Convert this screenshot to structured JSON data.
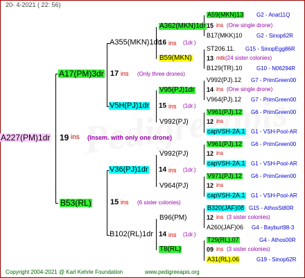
{
  "header": {
    "date": "20-  4-2021 ( 22: 56)"
  },
  "watermark": "Pedigreeapis",
  "root": {
    "name": "A227(PM)1dr",
    "ins_num": "19",
    "ins_text": "ins",
    "note": "(Insem. with only one drone)"
  },
  "gen1": [
    {
      "name": "A17(PM)3dr",
      "ins_num": "17",
      "ins_text": "ins",
      "note": "(Only three drones)"
    },
    {
      "name": "B53(RL)",
      "ins_num": "15",
      "ins_text": "ins",
      "note": "(6 sister colonies)"
    }
  ],
  "gen2": [
    {
      "name": "A355(MKN)1dr",
      "ins_num": "16",
      "ins_text": "ins",
      "note": "(1dr.)"
    },
    {
      "name": "V5H(PJ)1dr",
      "ins_num": "15",
      "ins_text": "ins",
      "note": "(1dr.)"
    },
    {
      "name": "V36(PJ)1dr",
      "ins_num": "14",
      "ins_text": "ins",
      "note": "(1dr.)"
    },
    {
      "name": "B102(RL)1dr",
      "ins_num": "14",
      "ins_text": "ins",
      "note": "(1dr.)"
    }
  ],
  "gen3": [
    {
      "name": "A362(MKN)1dr"
    },
    {
      "name": "B59(MKN)"
    },
    {
      "name": "V95(PJ)1dr"
    },
    {
      "name": "V992(PJ)"
    },
    {
      "name": "V992(PJ)"
    },
    {
      "name": "V964(PJ)"
    },
    {
      "name": "B96(PM)"
    },
    {
      "name": "T8(RL)"
    }
  ],
  "gen4": [
    {
      "top": "A59(MKN)13",
      "top_code": "G2 - Anat11Q",
      "count": "15",
      "count_text": "ins",
      "sub": "(One single drone)",
      "bottom": "B17(MKK)10",
      "bottom_code": "G2 - Sinop62R"
    },
    {
      "top": "ST206.11.",
      "top_code": "G15 - SinopEgg86R",
      "count": "13",
      "count_text": "mtk",
      "sub": "(24 sister colonies)",
      "bottom": "B129(TR).10",
      "bottom_code": "G10 - N06294R"
    },
    {
      "top": "V992(PJ).12",
      "top_code": "G7 - PrimGreen00",
      "count": "14",
      "count_text": "ins",
      "sub": "(One single drone)",
      "bottom": "V964(PJ).12",
      "bottom_code": "G7 - PrimGreen00"
    },
    {
      "top": "V961(PJ).12",
      "top_code": "G6 - PrimGreen00",
      "count": "12",
      "count_text": "ins",
      "sub": "",
      "bottom": "capVSH-2A.1",
      "bottom_code": "G1 - VSH-Pool-AR"
    },
    {
      "top": "V961(PJ).12",
      "top_code": "G6 - PrimGreen00",
      "count": "12",
      "count_text": "ins",
      "sub": "",
      "bottom": "capVSH-2A.1",
      "bottom_code": "G1 - VSH-Pool-AR"
    },
    {
      "top": "V971(PJ).12",
      "top_code": "G6 - PrimGreen00",
      "count": "12",
      "count_text": "ins",
      "sub": "",
      "bottom": "capVSH-2A.1",
      "bottom_code": "G1 - VSH-Pool-AR"
    },
    {
      "top": "B320(JAF)08",
      "top_code": "G15 - AthosSt80R",
      "count": "12",
      "count_text": "ins",
      "sub": "(3 sister colonies)",
      "bottom": "A260(JAF)06",
      "bottom_code": "G4 - Bayburt98-3"
    },
    {
      "top": "T29(RL).07",
      "top_code": "G4 - Athos00R",
      "count": "09",
      "count_text": "ins",
      "sub": "(3 sister colonies)",
      "bottom": "A31(RL).06",
      "bottom_code": "G19 - Sinop62R"
    }
  ],
  "footer": {
    "copyright": "Copyright 2004-2021 @ Karl Kehrle Foundation",
    "url": "www.pedigreeapis.org"
  },
  "colors": {
    "green": "#33ee33",
    "cyan": "#00ffff",
    "yellow": "#ffff00",
    "violet": "#ffccff",
    "frame": "#990000"
  }
}
